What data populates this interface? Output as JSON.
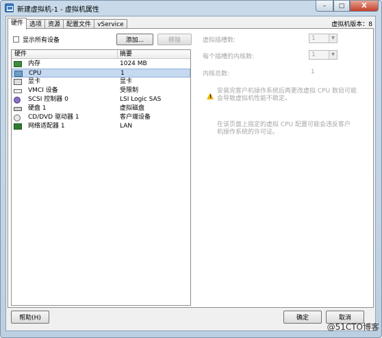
{
  "window": {
    "title": "新建虚拟机-1 - 虚拟机属性",
    "buttons": {
      "minimize": "–",
      "maximize": "□",
      "close": "X"
    }
  },
  "tabs": [
    "硬件",
    "选项",
    "资源",
    "配置文件",
    "vService"
  ],
  "version_label": "虚拟机版本：8",
  "toolbar": {
    "show_all_label": "显示所有设备",
    "add_label": "添加...",
    "remove_label": "移除"
  },
  "hardware_table": {
    "headers": {
      "name": "硬件",
      "summary": "摘要"
    },
    "rows": [
      {
        "icon": "memory-icon",
        "name": "内存",
        "summary": "1024 MB"
      },
      {
        "icon": "cpu-icon",
        "name": "CPU",
        "summary": "1"
      },
      {
        "icon": "video-card-icon",
        "name": "显卡",
        "summary": "显卡"
      },
      {
        "icon": "vmci-icon",
        "name": "VMCI 设备",
        "summary": "受限制"
      },
      {
        "icon": "scsi-icon",
        "name": "SCSI 控制器 0",
        "summary": "LSI Logic SAS"
      },
      {
        "icon": "hard-disk-icon",
        "name": "硬盘 1",
        "summary": "虚拟磁盘"
      },
      {
        "icon": "cd-dvd-icon",
        "name": "CD/DVD 驱动器 1",
        "summary": "客户端设备"
      },
      {
        "icon": "network-adapter-icon",
        "name": "网络适配器 1",
        "summary": "LAN"
      }
    ],
    "selected_index": 1
  },
  "cpu_panel": {
    "sockets_label": "虚拟插槽数:",
    "sockets_value": "1",
    "cores_label": "每个插槽的内核数:",
    "cores_value": "1",
    "total_label": "内核总数:",
    "total_value": "1",
    "warning_line1": "安装完客户机操作系统后再更改虚拟 CPU 数目可能",
    "warning_line2": "会导致虚拟机性能不稳定。",
    "info_line1": "在该页面上指定的虚拟 CPU 配置可能会违反客户",
    "info_line2": "机操作系统的许可证。"
  },
  "footer": {
    "help_label": "帮助(H)",
    "ok_label": "确定",
    "cancel_label": "取消",
    "watermark": "@51CTO博客"
  }
}
